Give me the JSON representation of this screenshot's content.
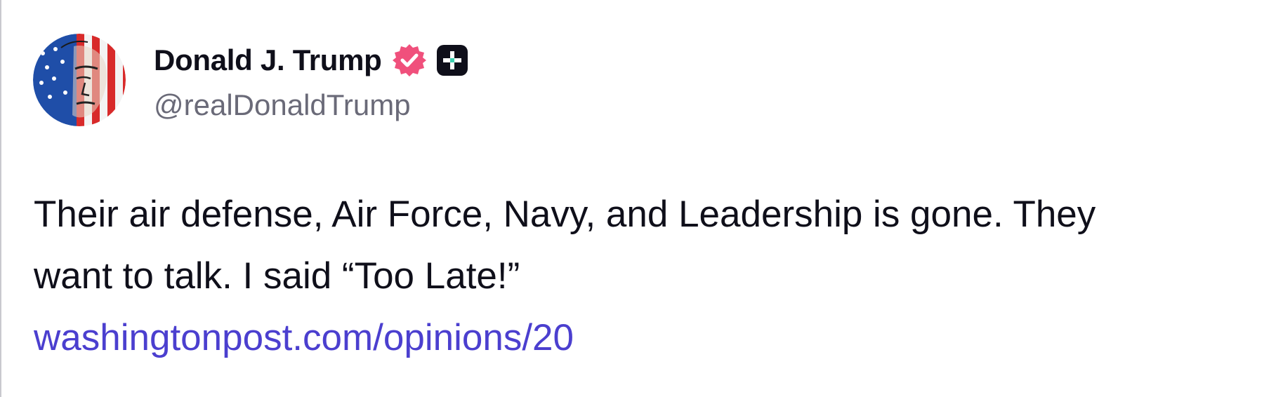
{
  "post": {
    "author": {
      "display_name": "Donald J. Trump",
      "handle": "@realDonaldTrump",
      "avatar_icon": "flag-portrait-avatar",
      "verified_icon": "verified-badge-icon",
      "verified_color": "#f0507c",
      "plus_icon": "plus-badge-icon"
    },
    "text_lines": [
      "Their air defense, Air Force, Navy, and Leadership is gone. They",
      "want to talk. I said “Too Late!”"
    ],
    "link": "washingtonpost.com/opinions/20",
    "colors": {
      "text": "#0f0f1a",
      "handle": "#6a6a78",
      "link": "#4b3fcf"
    }
  }
}
